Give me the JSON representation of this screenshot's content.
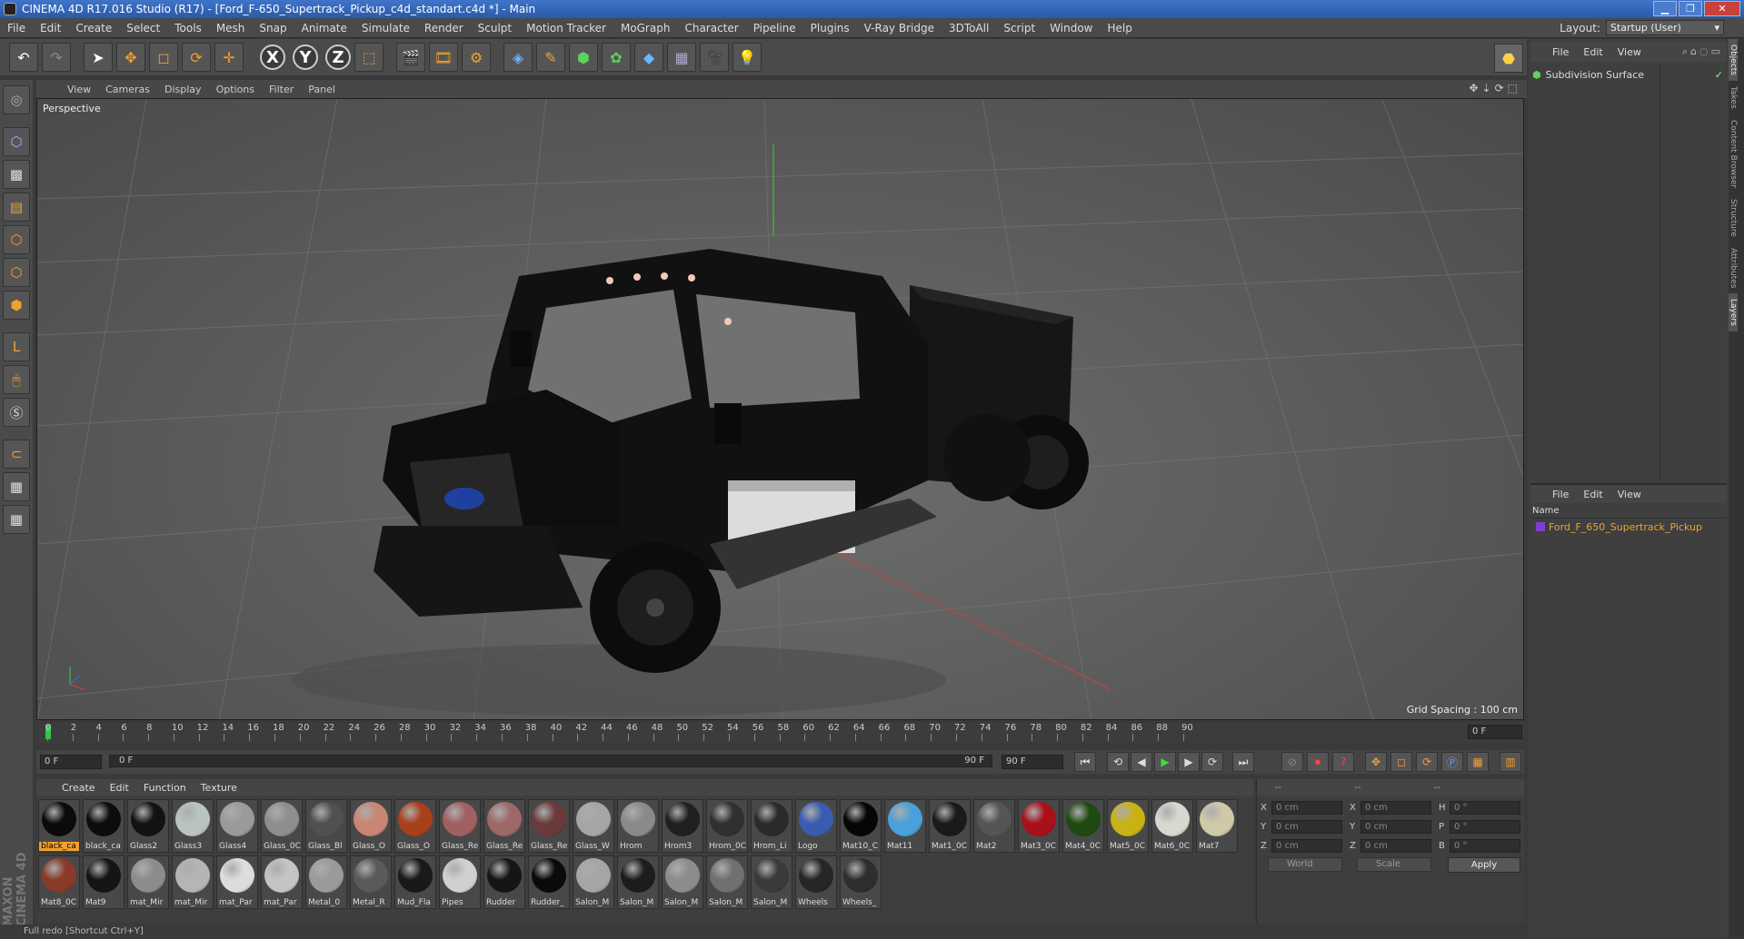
{
  "window": {
    "title": "CINEMA 4D R17.016 Studio (R17) - [Ford_F-650_Supertrack_Pickup_c4d_standart.c4d *] - Main"
  },
  "menubar": {
    "items": [
      "File",
      "Edit",
      "Create",
      "Select",
      "Tools",
      "Mesh",
      "Snap",
      "Animate",
      "Simulate",
      "Render",
      "Sculpt",
      "Motion Tracker",
      "MoGraph",
      "Character",
      "Pipeline",
      "Plugins",
      "V-Ray Bridge",
      "3DToAll",
      "Script",
      "Window",
      "Help"
    ],
    "layout_label": "Layout:",
    "layout_value": "Startup (User)"
  },
  "viewport": {
    "menu": [
      "View",
      "Cameras",
      "Display",
      "Options",
      "Filter",
      "Panel"
    ],
    "label": "Perspective",
    "grid_spacing": "Grid Spacing : 100 cm"
  },
  "objects": {
    "menu": [
      "File",
      "Edit",
      "View"
    ],
    "items": [
      {
        "name": "Subdivision Surface"
      }
    ]
  },
  "layers": {
    "menu": [
      "File",
      "Edit",
      "View"
    ],
    "column": "Name",
    "items": [
      {
        "name": "Ford_F_650_Supertrack_Pickup"
      }
    ]
  },
  "side_tabs": [
    "Objects",
    "Takes",
    "Content Browser",
    "Structure",
    "Attributes",
    "Layers"
  ],
  "timeline": {
    "ticks": [
      "0",
      "2",
      "4",
      "6",
      "8",
      "10",
      "12",
      "14",
      "16",
      "18",
      "20",
      "22",
      "24",
      "26",
      "28",
      "30",
      "32",
      "34",
      "36",
      "38",
      "40",
      "42",
      "44",
      "46",
      "48",
      "50",
      "52",
      "54",
      "56",
      "58",
      "60",
      "62",
      "64",
      "66",
      "68",
      "70",
      "72",
      "74",
      "76",
      "78",
      "80",
      "82",
      "84",
      "86",
      "88",
      "90"
    ],
    "current_frame": "0 F",
    "start_frame": "0 F",
    "range_start": "0 F",
    "range_end": "90 F",
    "end_frame": "90 F"
  },
  "materials": {
    "menu": [
      "Create",
      "Edit",
      "Function",
      "Texture"
    ],
    "items": [
      {
        "name": "black_ca",
        "color": "#0b0b0b"
      },
      {
        "name": "black_ca",
        "color": "#0d0d0d"
      },
      {
        "name": "Glass2",
        "color": "#121212"
      },
      {
        "name": "Glass3",
        "color": "#b9c4c2"
      },
      {
        "name": "Glass4",
        "color": "#9a9a9a"
      },
      {
        "name": "Glass_0C",
        "color": "#8e8e8e"
      },
      {
        "name": "Glass_Bl",
        "color": "#505050"
      },
      {
        "name": "Glass_O",
        "color": "#c98675"
      },
      {
        "name": "Glass_O",
        "color": "#a8401c"
      },
      {
        "name": "Glass_Re",
        "color": "#a06060"
      },
      {
        "name": "Glass_Re",
        "color": "#9c6868"
      },
      {
        "name": "Glass_Re",
        "color": "#6b3b3b"
      },
      {
        "name": "Glass_W",
        "color": "#a5a5a5"
      },
      {
        "name": "Hrom",
        "color": "#8a8a8a"
      },
      {
        "name": "Hrom3",
        "color": "#202020"
      },
      {
        "name": "Hrom_0C",
        "color": "#303030"
      },
      {
        "name": "Hrom_Li",
        "color": "#2a2a2a"
      },
      {
        "name": "Logo",
        "color": "#3a5cb0"
      },
      {
        "name": "Mat10_C",
        "color": "#060606"
      },
      {
        "name": "Mat11",
        "color": "#4aa0d8"
      },
      {
        "name": "Mat1_0C",
        "color": "#1a1a1a"
      },
      {
        "name": "Mat2",
        "color": "#555555"
      },
      {
        "name": "Mat3_0C",
        "color": "#a8101a"
      },
      {
        "name": "Mat4_0C",
        "color": "#1e4a12"
      },
      {
        "name": "Mat5_0C",
        "color": "#c8b214"
      },
      {
        "name": "Mat6_0C",
        "color": "#d8d8d0"
      },
      {
        "name": "Mat7",
        "color": "#cfc9a8"
      },
      {
        "name": "Mat8_0C",
        "color": "#8a3a28"
      },
      {
        "name": "Mat9",
        "color": "#151515"
      },
      {
        "name": "mat_Mir",
        "color": "#8c8c8c"
      },
      {
        "name": "mat_Mir",
        "color": "#b5b5b5"
      },
      {
        "name": "mat_Par",
        "color": "#dcdcdc"
      },
      {
        "name": "mat_Par",
        "color": "#c4c4c4"
      },
      {
        "name": "Metal_0",
        "color": "#9a9a9a"
      },
      {
        "name": "Metal_R",
        "color": "#5a5a5a"
      },
      {
        "name": "Mud_Fla",
        "color": "#191919"
      },
      {
        "name": "Pipes",
        "color": "#d0d0d0"
      },
      {
        "name": "Rudder",
        "color": "#151515"
      },
      {
        "name": "Rudder_",
        "color": "#0a0a0a"
      },
      {
        "name": "Salon_M",
        "color": "#a5a5a5"
      },
      {
        "name": "Salon_M",
        "color": "#1d1d1d"
      },
      {
        "name": "Salon_M",
        "color": "#8c8c8c"
      },
      {
        "name": "Salon_M",
        "color": "#707070"
      },
      {
        "name": "Salon_M",
        "color": "#3a3a3a"
      },
      {
        "name": "Wheels",
        "color": "#262626"
      },
      {
        "name": "Wheels_",
        "color": "#2e2e2e"
      }
    ]
  },
  "coordinates": {
    "head": [
      "--",
      "--",
      "--"
    ],
    "rows": [
      {
        "a": "X",
        "av": "0 cm",
        "b": "X",
        "bv": "0 cm",
        "c": "H",
        "cv": "0 °"
      },
      {
        "a": "Y",
        "av": "0 cm",
        "b": "Y",
        "bv": "0 cm",
        "c": "P",
        "cv": "0 °"
      },
      {
        "a": "Z",
        "av": "0 cm",
        "b": "Z",
        "bv": "0 cm",
        "c": "B",
        "cv": "0 °"
      }
    ],
    "world": "World",
    "scale": "Scale",
    "apply": "Apply"
  },
  "status": "Full redo [Shortcut Ctrl+Y]",
  "brand": "MAXON CINEMA 4D"
}
